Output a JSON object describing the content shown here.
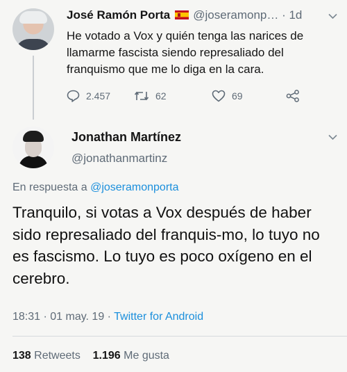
{
  "tweet1": {
    "name": "José Ramón Porta",
    "handle": "@joseramonp…",
    "time": "· 1d",
    "text": "He votado a Vox y quién tenga las narices de llamarme fascista siendo represaliado del franquismo que me lo diga en la cara.",
    "replies": "2.457",
    "retweets": "62",
    "likes": "69"
  },
  "tweet2": {
    "name": "Jonathan Martínez",
    "handle": "@jonathanmartinz",
    "reply_prefix": "En respuesta a",
    "reply_to": "@joseramonporta",
    "text": "Tranquilo, si votas a Vox después de haber sido represaliado del franquis-mo, lo tuyo no es fascismo. Lo tuyo es poco oxígeno en el cerebro.",
    "timestamp": "18:31 · 01 may. 19 ·",
    "source": "Twitter for Android",
    "retweet_count": "138",
    "retweet_label": "Retweets",
    "like_count": "1.196",
    "like_label": "Me gusta"
  },
  "colors": {
    "link": "#1b8fdc",
    "secondary": "#5f6b77"
  },
  "icons": [
    "reply-icon",
    "retweet-icon",
    "like-icon",
    "share-icon",
    "chevron-down-icon"
  ]
}
